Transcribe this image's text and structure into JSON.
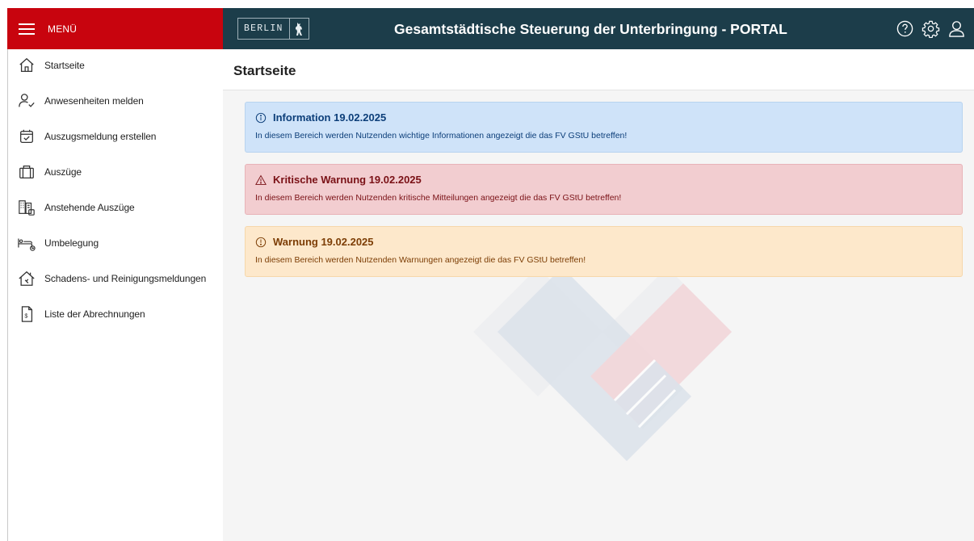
{
  "menu": {
    "label": "MENÜ"
  },
  "header": {
    "logo_text": "BERLIN",
    "title": "Gesamtstädtische Steuerung der Unterbringung - PORTAL",
    "icons": [
      "help-icon",
      "settings-icon",
      "user-icon"
    ]
  },
  "sidebar": {
    "items": [
      {
        "label": "Startseite",
        "icon": "home-icon"
      },
      {
        "label": "Anwesenheiten melden",
        "icon": "person-check-icon"
      },
      {
        "label": "Auszugsmeldung erstellen",
        "icon": "calendar-check-icon"
      },
      {
        "label": "Auszüge",
        "icon": "briefcase-icon"
      },
      {
        "label": "Anstehende Auszüge",
        "icon": "buildings-icon"
      },
      {
        "label": "Umbelegung",
        "icon": "bed-move-icon"
      },
      {
        "label": "Schadens- und Reinigungsmeldungen",
        "icon": "house-repair-icon"
      },
      {
        "label": "Liste der Abrechnungen",
        "icon": "invoice-icon"
      }
    ]
  },
  "main": {
    "page_title": "Startseite",
    "alerts": [
      {
        "type": "info",
        "icon": "info-icon",
        "title": "Information 19.02.2025",
        "text": "In diesem Bereich werden Nutzenden wichtige Informationen angezeigt die das FV GStU betreffen!"
      },
      {
        "type": "critical",
        "icon": "warning-triangle-icon",
        "title": "Kritische Warnung 19.02.2025",
        "text": "In diesem Bereich werden Nutzenden kritische Mitteilungen angezeigt die das FV GStU betreffen!"
      },
      {
        "type": "warning",
        "icon": "exclamation-circle-icon",
        "title": "Warnung 19.02.2025",
        "text": "In diesem Bereich werden Nutzenden Warnungen angezeigt die das FV GStU betreffen!"
      }
    ]
  },
  "colors": {
    "menu_red": "#c8040e",
    "header_dark": "#1c3d4a",
    "info_bg": "#cfe3f9",
    "critical_bg": "#f2cdd0",
    "warning_bg": "#fde8cb"
  }
}
